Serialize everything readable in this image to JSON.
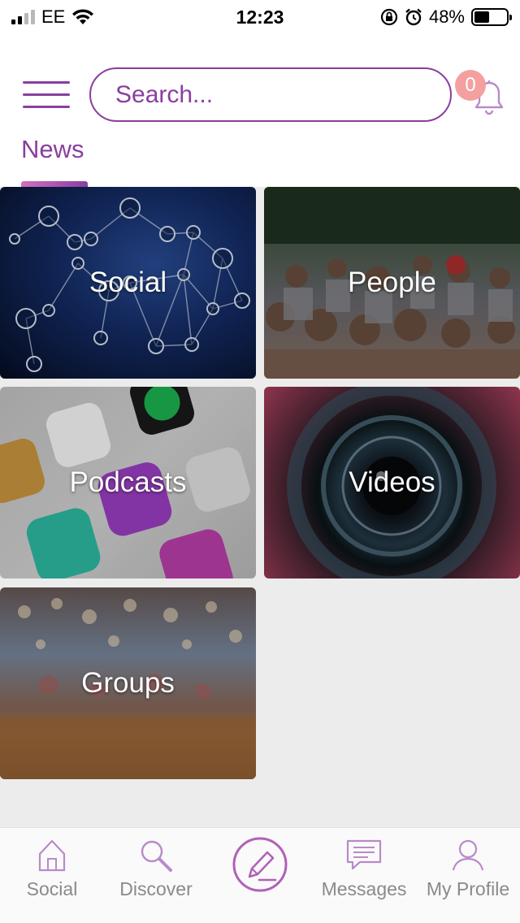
{
  "status_bar": {
    "carrier": "EE",
    "time": "12:23",
    "battery_percent": "48%",
    "battery_level": 0.48,
    "icons": [
      "signal-icon",
      "wifi-icon",
      "rotation-lock-icon",
      "alarm-icon",
      "battery-icon"
    ]
  },
  "header": {
    "search_placeholder": "Search...",
    "notification_count": "0",
    "icons": [
      "hamburger-menu-icon",
      "bell-icon"
    ]
  },
  "tabs": [
    {
      "label": "News",
      "active": true
    }
  ],
  "tiles": [
    {
      "label": "Social"
    },
    {
      "label": "People"
    },
    {
      "label": "Podcasts"
    },
    {
      "label": "Videos"
    },
    {
      "label": "Groups"
    }
  ],
  "bottom_nav": [
    {
      "label": "Social",
      "icon": "home-icon"
    },
    {
      "label": "Discover",
      "icon": "magnifier-icon"
    },
    {
      "label": "",
      "icon": "compose-pencil-icon"
    },
    {
      "label": "Messages",
      "icon": "chat-bubble-icon"
    },
    {
      "label": "My Profile",
      "icon": "user-icon"
    }
  ],
  "colors": {
    "accent": "#8a3ea0",
    "badge": "#f4a0a0",
    "nav_text": "#8a8a8a",
    "grid_background": "#ececec"
  }
}
